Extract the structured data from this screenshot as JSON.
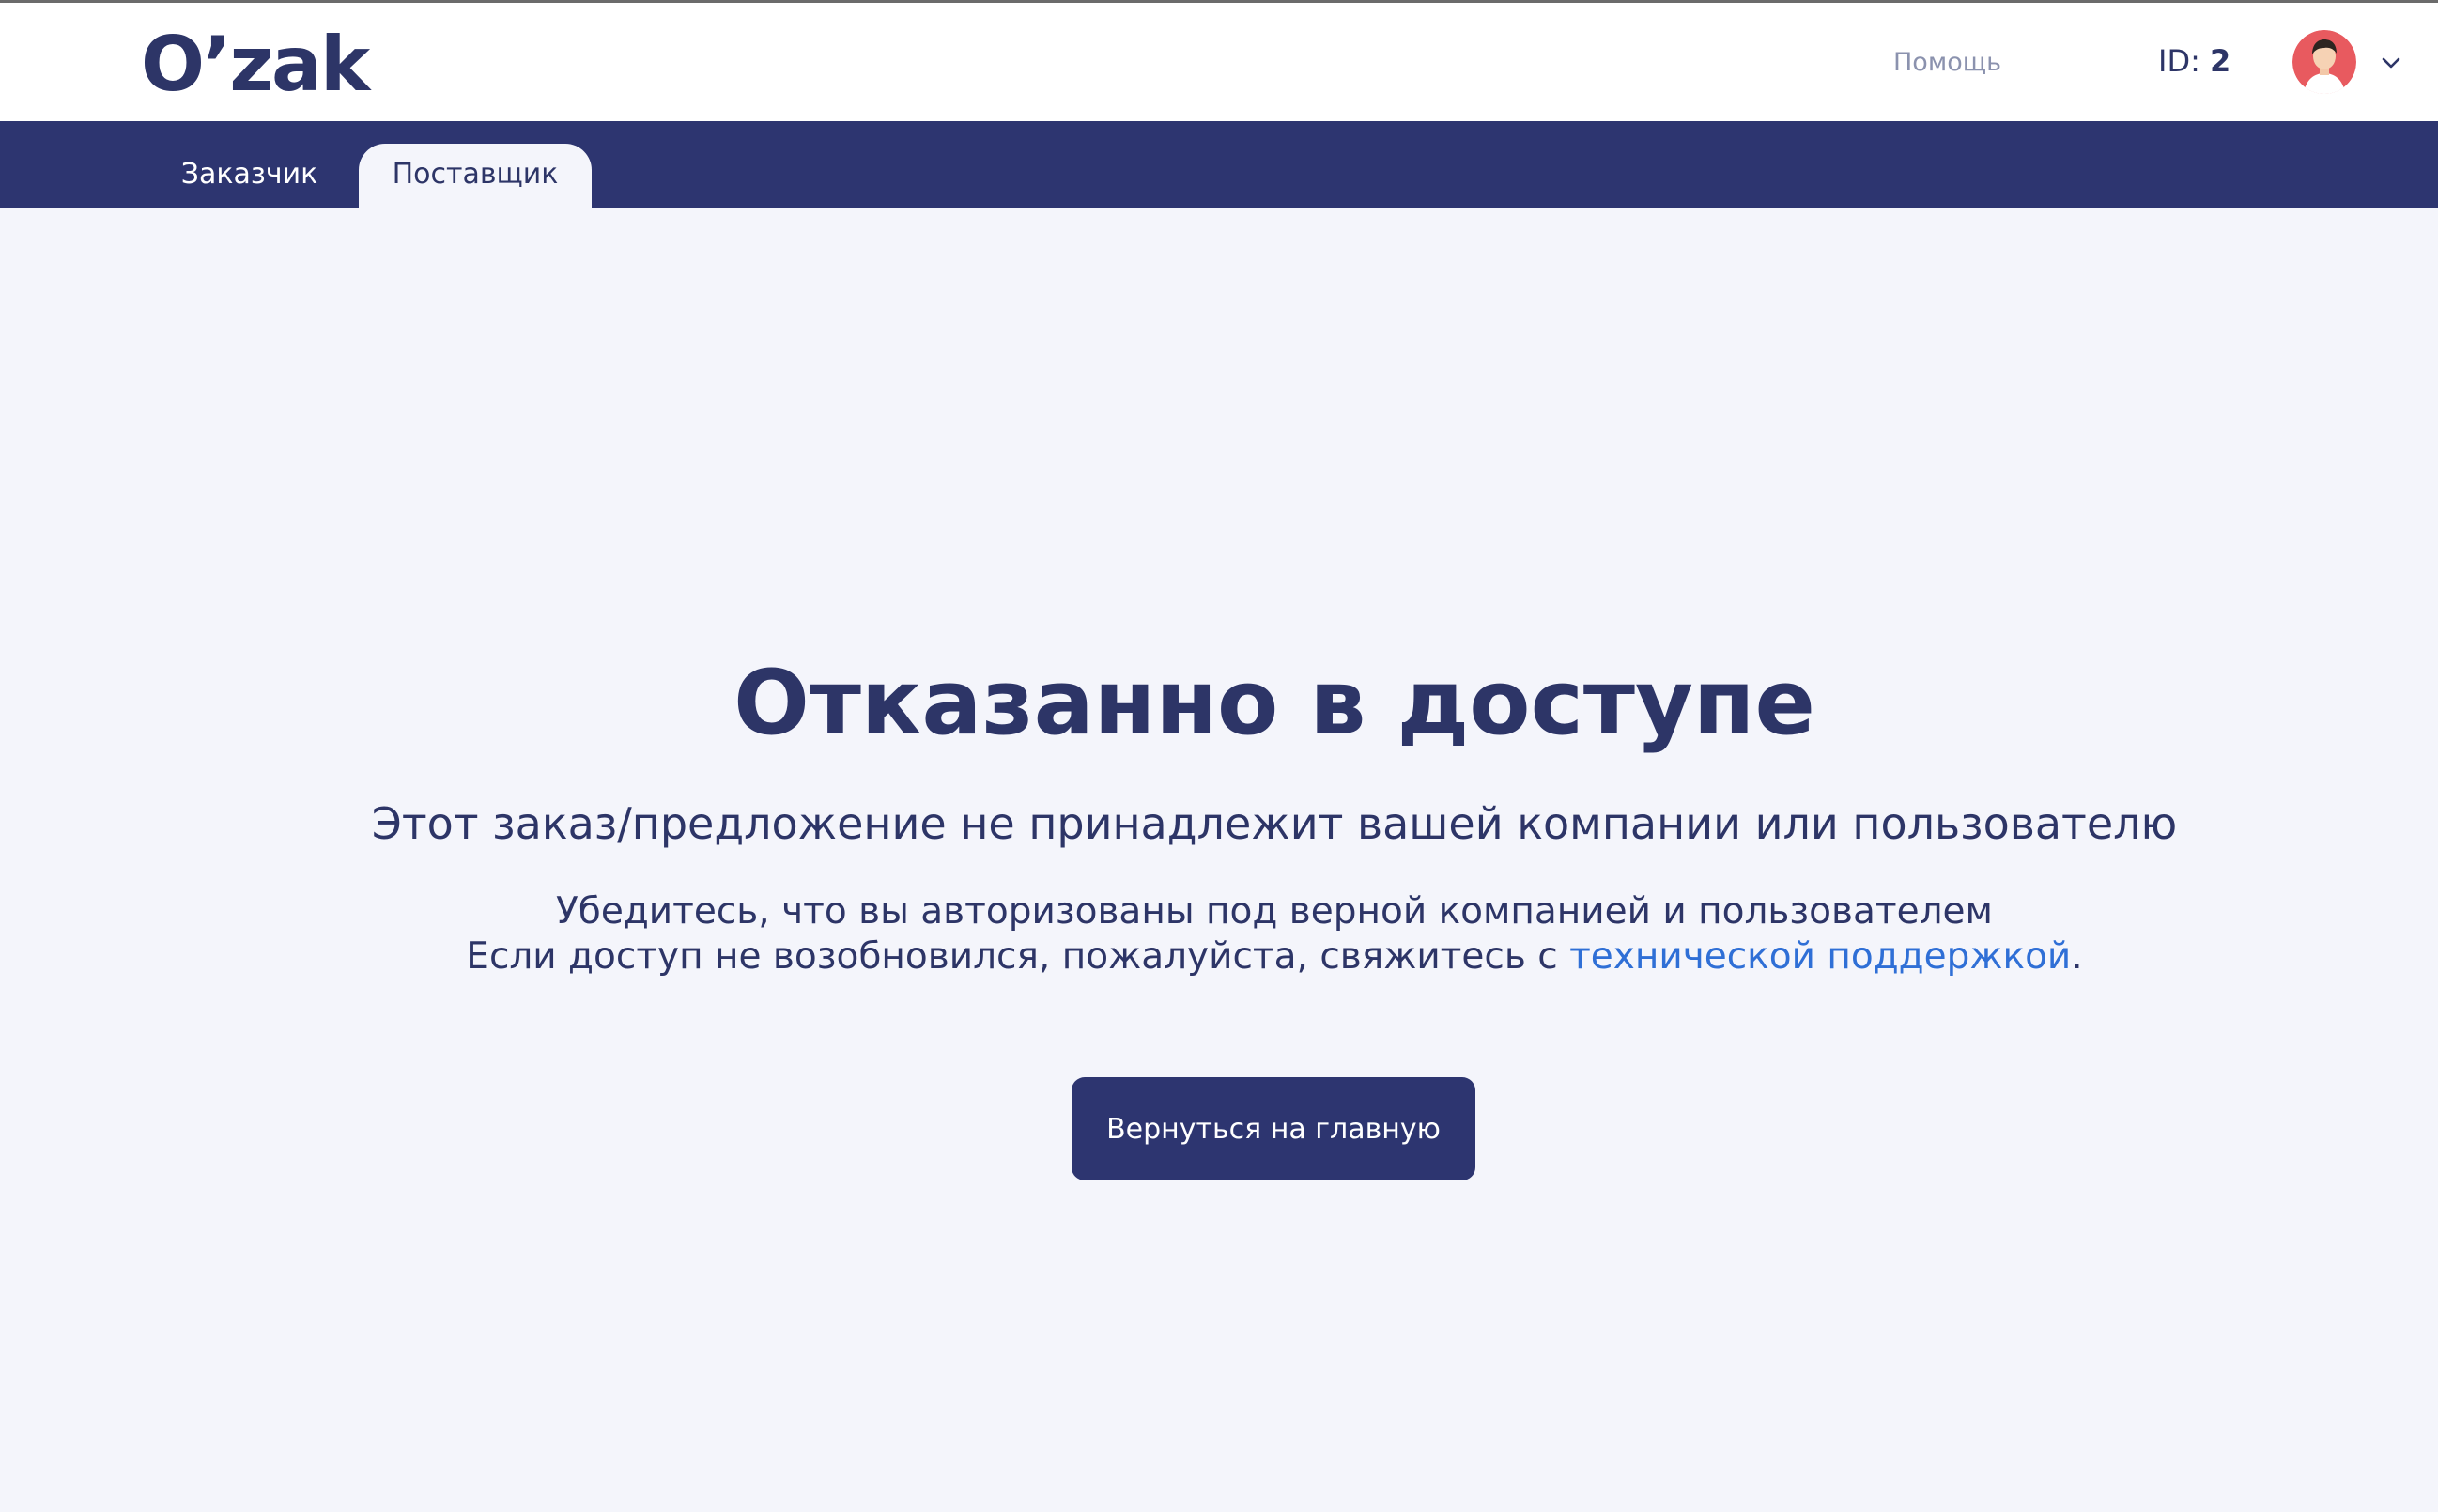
{
  "header": {
    "logo": "O’zak",
    "help_label": "Помощь",
    "id_label": "ID:",
    "id_value": "2",
    "avatar_icon": "user-avatar-icon",
    "dropdown_icon": "chevron-down-icon"
  },
  "tabs": [
    {
      "label": "Заказчик",
      "active": false
    },
    {
      "label": "Поставщик",
      "active": true
    }
  ],
  "main": {
    "title": "Отказанно в доступе",
    "subtitle": "Этот заказ/предложение не принадлежит вашей компании или пользователю",
    "info_line1": "Убедитесь, что вы авторизованы под верной компанией и пользователем",
    "info_line2_prefix": "Если доступ не возобновился, пожалуйста, свяжитесь с ",
    "support_link": "технической поддержкой",
    "info_line2_suffix": ".",
    "home_button": "Вернуться на главную"
  },
  "colors": {
    "brand_navy": "#2d3570",
    "background": "#f4f5fb",
    "link_blue": "#2f6fd6",
    "avatar_red": "#e85a5f"
  }
}
